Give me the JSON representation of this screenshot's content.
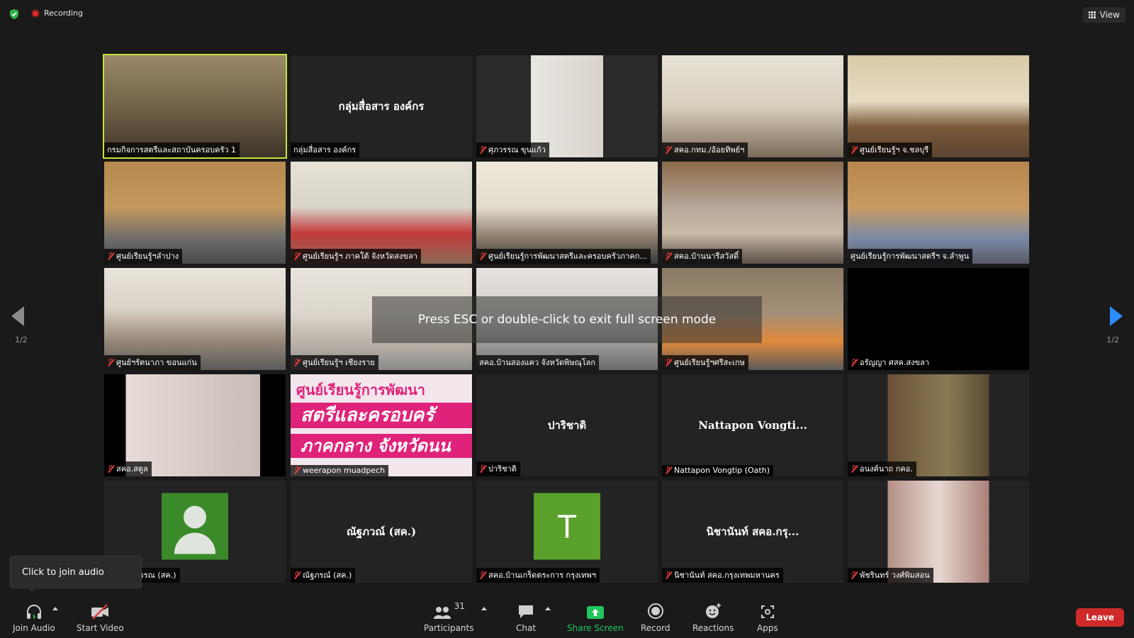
{
  "top_bar": {
    "recording_label": "Recording",
    "view_label": "View"
  },
  "tiles": [
    {
      "name": "กรมกิจการสตรีและสถาบันครอบครัว 1",
      "muted": false,
      "active": true,
      "video": true
    },
    {
      "name": "กลุ่มสื่อสาร องค์กร",
      "display_name": "กลุ่มสื่อสาร องค์กร",
      "muted": false,
      "video": false
    },
    {
      "name": "ศุภวรรณ ขุนแก้ว",
      "muted": true,
      "video": true
    },
    {
      "name": "สคอ.กทม./อ้อยทิพย์ฯ",
      "muted": true,
      "video": true
    },
    {
      "name": "ศูนย์เรียนรู้ฯ จ.ชลบุรี",
      "muted": true,
      "video": true
    },
    {
      "name": "ศูนย์เรียนรู้ฯลำปาง",
      "muted": true,
      "video": true
    },
    {
      "name": "ศูนย์เรียนรู้ฯ ภาคใต้ จังหวัดสงขลา",
      "muted": true,
      "video": true
    },
    {
      "name": "ศูนย์เรียนรู้การพัฒนาสตรีและครอบครัวภาคก...",
      "muted": true,
      "video": true
    },
    {
      "name": "สคอ.บ้านนารีสวัสดิ์",
      "muted": true,
      "video": true
    },
    {
      "name": "ศูนย์เรียนรู้การพัฒนาสตรีฯ จ.ลำพูน",
      "muted": false,
      "video": true
    },
    {
      "name": "ศูนย์ฯรัตนาภา ขอนแก่น",
      "muted": true,
      "video": true
    },
    {
      "name": "ศูนย์เรียนรู้ฯ เชียงราย",
      "muted": true,
      "video": true
    },
    {
      "name": "สคอ.บ้านสองแคว จังหวัดพิษณุโลก",
      "muted": false,
      "video": true
    },
    {
      "name": "ศูนย์เรียนรู้ฯศรีสะเกษ",
      "muted": true,
      "video": true
    },
    {
      "name": "อรัญญา ศสค.สงขลา",
      "muted": true,
      "video": false
    },
    {
      "name": "สคอ.สตูล",
      "muted": true,
      "video": true
    },
    {
      "name": "weerapon muadpech",
      "muted": true,
      "video": true
    },
    {
      "name": "ปาริชาติ",
      "display_name": "ปาริชาติ",
      "muted": true,
      "video": false
    },
    {
      "name": "Nattapon Vongtip (Oath)",
      "display_name": "Nattapon Vongti...",
      "muted": true,
      "video": false
    },
    {
      "name": "อนงค์นาถ กคอ.",
      "muted": true,
      "video": true
    },
    {
      "name": "รัตนศิราวรรณ (สค.)",
      "muted": false,
      "video": false
    },
    {
      "name": "ณัฐภรณ์ (สค.)",
      "display_name": "ณัฐภวณ์ (สค.)",
      "muted": true,
      "video": false
    },
    {
      "name": "สคอ.บ้านเกร็ดตระการ กรุงเทพฯ",
      "muted": true,
      "video": false,
      "avatar_letter": "T"
    },
    {
      "name": "นิชานันท์ สคอ.กรุงเทพมหานคร",
      "display_name": "นิชานันท์ สคอ.กรุ...",
      "muted": true,
      "video": false
    },
    {
      "name": "พัชรินทร์ วงศ์พิมสอน",
      "muted": true,
      "video": true
    }
  ],
  "banner_tile": {
    "line1": "ศูนย์เรียนรู้การพัฒนา",
    "line2": "สตรีและครอบครั",
    "line3": "ภาคกลาง จังหวัดนน"
  },
  "fullscreen_message": "Press ESC or double-click to exit full screen mode",
  "pagination": {
    "left": "1/2",
    "right": "1/2"
  },
  "tooltip": "Click to join audio",
  "toolbar": {
    "join_audio": "Join Audio",
    "start_video": "Start Video",
    "participants": "Participants",
    "participants_count": "31",
    "chat": "Chat",
    "share_screen": "Share Screen",
    "record": "Record",
    "reactions": "Reactions",
    "apps": "Apps",
    "leave": "Leave"
  },
  "colors": {
    "active_speaker_border": "#c6e23c",
    "share_screen": "#23c55e",
    "leave": "#cf2a2a",
    "next_arrow": "#2d8cff"
  }
}
